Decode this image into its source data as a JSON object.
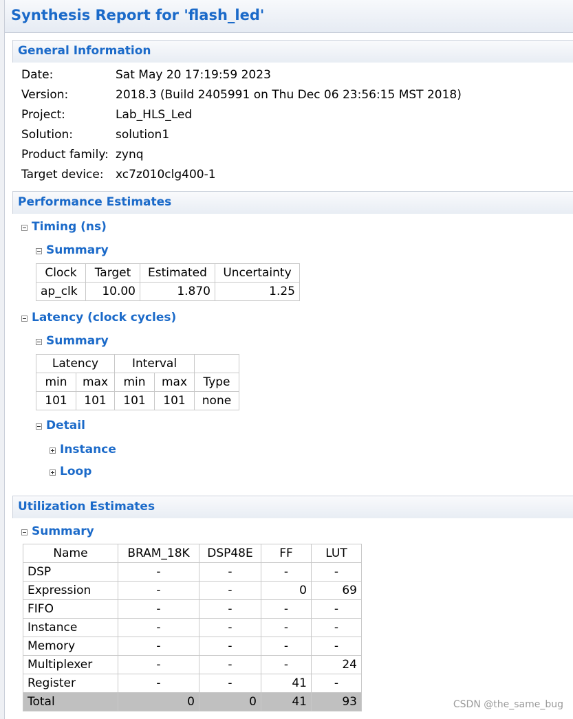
{
  "title": "Synthesis Report for 'flash_led'",
  "general": {
    "header": "General Information",
    "rows": [
      {
        "label": "Date:",
        "value": "Sat May 20 17:19:59 2023"
      },
      {
        "label": "Version:",
        "value": "2018.3 (Build 2405991 on Thu Dec 06 23:56:15 MST 2018)"
      },
      {
        "label": "Project:",
        "value": "Lab_HLS_Led"
      },
      {
        "label": "Solution:",
        "value": "solution1"
      },
      {
        "label": "Product family:",
        "value": "zynq"
      },
      {
        "label": "Target device:",
        "value": "xc7z010clg400-1"
      }
    ]
  },
  "performance": {
    "header": "Performance Estimates",
    "timing": {
      "label": "Timing (ns)",
      "summary_label": "Summary",
      "columns": [
        "Clock",
        "Target",
        "Estimated",
        "Uncertainty"
      ],
      "row": [
        "ap_clk",
        "10.00",
        "1.870",
        "1.25"
      ]
    },
    "latency": {
      "label": "Latency (clock cycles)",
      "summary_label": "Summary",
      "group_headers": [
        "Latency",
        "Interval"
      ],
      "columns": [
        "min",
        "max",
        "min",
        "max",
        "Type"
      ],
      "row": [
        "101",
        "101",
        "101",
        "101",
        "none"
      ],
      "detail_label": "Detail",
      "instance_label": "Instance",
      "loop_label": "Loop"
    }
  },
  "utilization": {
    "header": "Utilization Estimates",
    "summary_label": "Summary",
    "columns": [
      "Name",
      "BRAM_18K",
      "DSP48E",
      "FF",
      "LUT"
    ],
    "rows": [
      [
        "DSP",
        "-",
        "-",
        "-",
        "-"
      ],
      [
        "Expression",
        "-",
        "-",
        "0",
        "69"
      ],
      [
        "FIFO",
        "-",
        "-",
        "-",
        "-"
      ],
      [
        "Instance",
        "-",
        "-",
        "-",
        "-"
      ],
      [
        "Memory",
        "-",
        "-",
        "-",
        "-"
      ],
      [
        "Multiplexer",
        "-",
        "-",
        "-",
        "24"
      ],
      [
        "Register",
        "-",
        "-",
        "41",
        "-"
      ],
      [
        "Total",
        "0",
        "0",
        "41",
        "93"
      ]
    ]
  },
  "watermark": "CSDN @the_same_bug",
  "colors": {
    "accent": "#1b6ac9",
    "total_row": "#c0c0c0"
  }
}
